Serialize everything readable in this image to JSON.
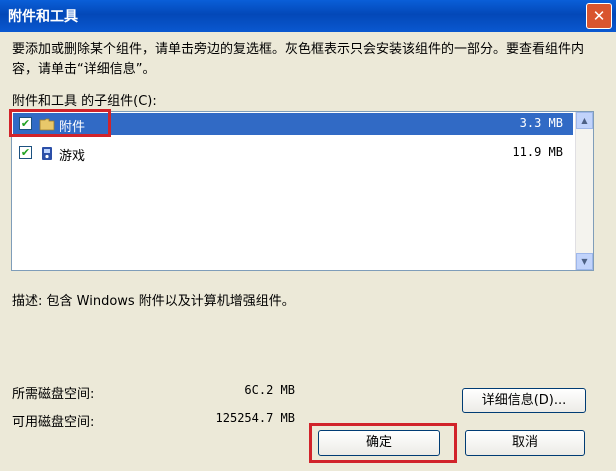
{
  "window": {
    "title": "附件和工具",
    "close_label": "✕"
  },
  "description_top": "要添加或删除某个组件，请单击旁边的复选框。灰色框表示只会安装该组件的一部分。要查看组件内容，请单击“详细信息”。",
  "list": {
    "label": "附件和工具 的子组件(C):",
    "items": [
      {
        "label": "附件",
        "size": "3.3 MB",
        "checked": true,
        "selected": true,
        "icon": "folder-icon"
      },
      {
        "label": "游戏",
        "size": "11.9 MB",
        "checked": true,
        "selected": false,
        "icon": "games-icon"
      }
    ]
  },
  "description": "描述:  包含 Windows 附件以及计算机增强组件。",
  "disk": {
    "required_label": "所需磁盘空间:",
    "required_value": "6C.2 MB",
    "available_label": "可用磁盘空间:",
    "available_value": "125254.7 MB"
  },
  "buttons": {
    "details": "详细信息(D)...",
    "ok": "确定",
    "cancel": "取消"
  },
  "colors": {
    "highlight": "#d1232a",
    "selection": "#316ac5",
    "titlebar": "#0a58d0"
  }
}
